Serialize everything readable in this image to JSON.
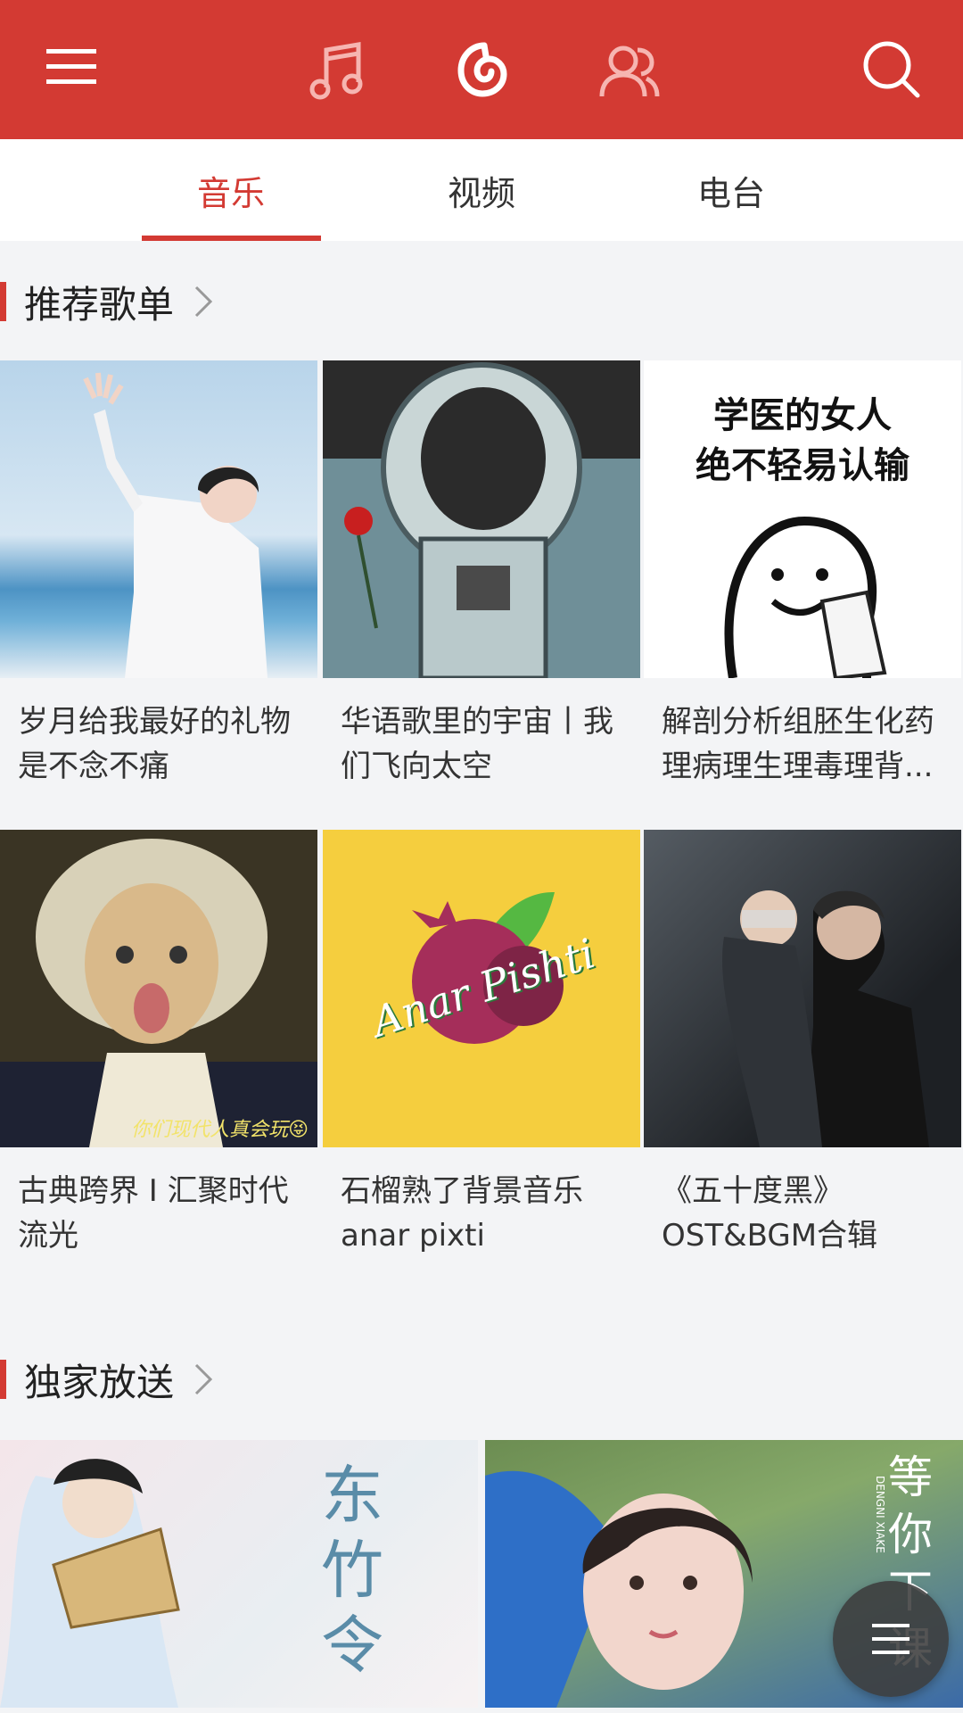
{
  "tabs": [
    {
      "label": "音乐",
      "active": true
    },
    {
      "label": "视频",
      "active": false
    },
    {
      "label": "电台",
      "active": false
    }
  ],
  "sections": {
    "recommended": {
      "title": "推荐歌单"
    },
    "exclusive": {
      "title": "独家放送"
    }
  },
  "playlists": [
    {
      "caption": "岁月给我最好的礼物是不念不痛"
    },
    {
      "caption": "华语歌里的宇宙丨我们飞向太空"
    },
    {
      "caption": "解剖分析组胚生化药理病理生理毒理背...",
      "thumb_text": [
        "学医的女人",
        "绝不轻易认输"
      ]
    },
    {
      "caption": "古典跨界 I 汇聚时代流光",
      "overlay": "你们现代人真会玩😝"
    },
    {
      "caption": "石榴熟了背景音乐anar pixti",
      "thumb_text": [
        "Anar Pishti"
      ]
    },
    {
      "caption": "《五十度黑》OST&BGM合辑"
    }
  ],
  "exclusive_items": [
    {
      "thumb_text": "东竹令"
    },
    {
      "thumb_text": "等你下课",
      "pinyin": "DENGNI XIAKE"
    }
  ],
  "icons": {
    "menu": "menu-icon",
    "music": "music-note-icon",
    "netease": "netease-logo-icon",
    "friends": "friends-icon",
    "search": "search-icon",
    "fab": "list-icon"
  },
  "colors": {
    "brand": "#d33a33",
    "background": "#f3f4f6"
  }
}
